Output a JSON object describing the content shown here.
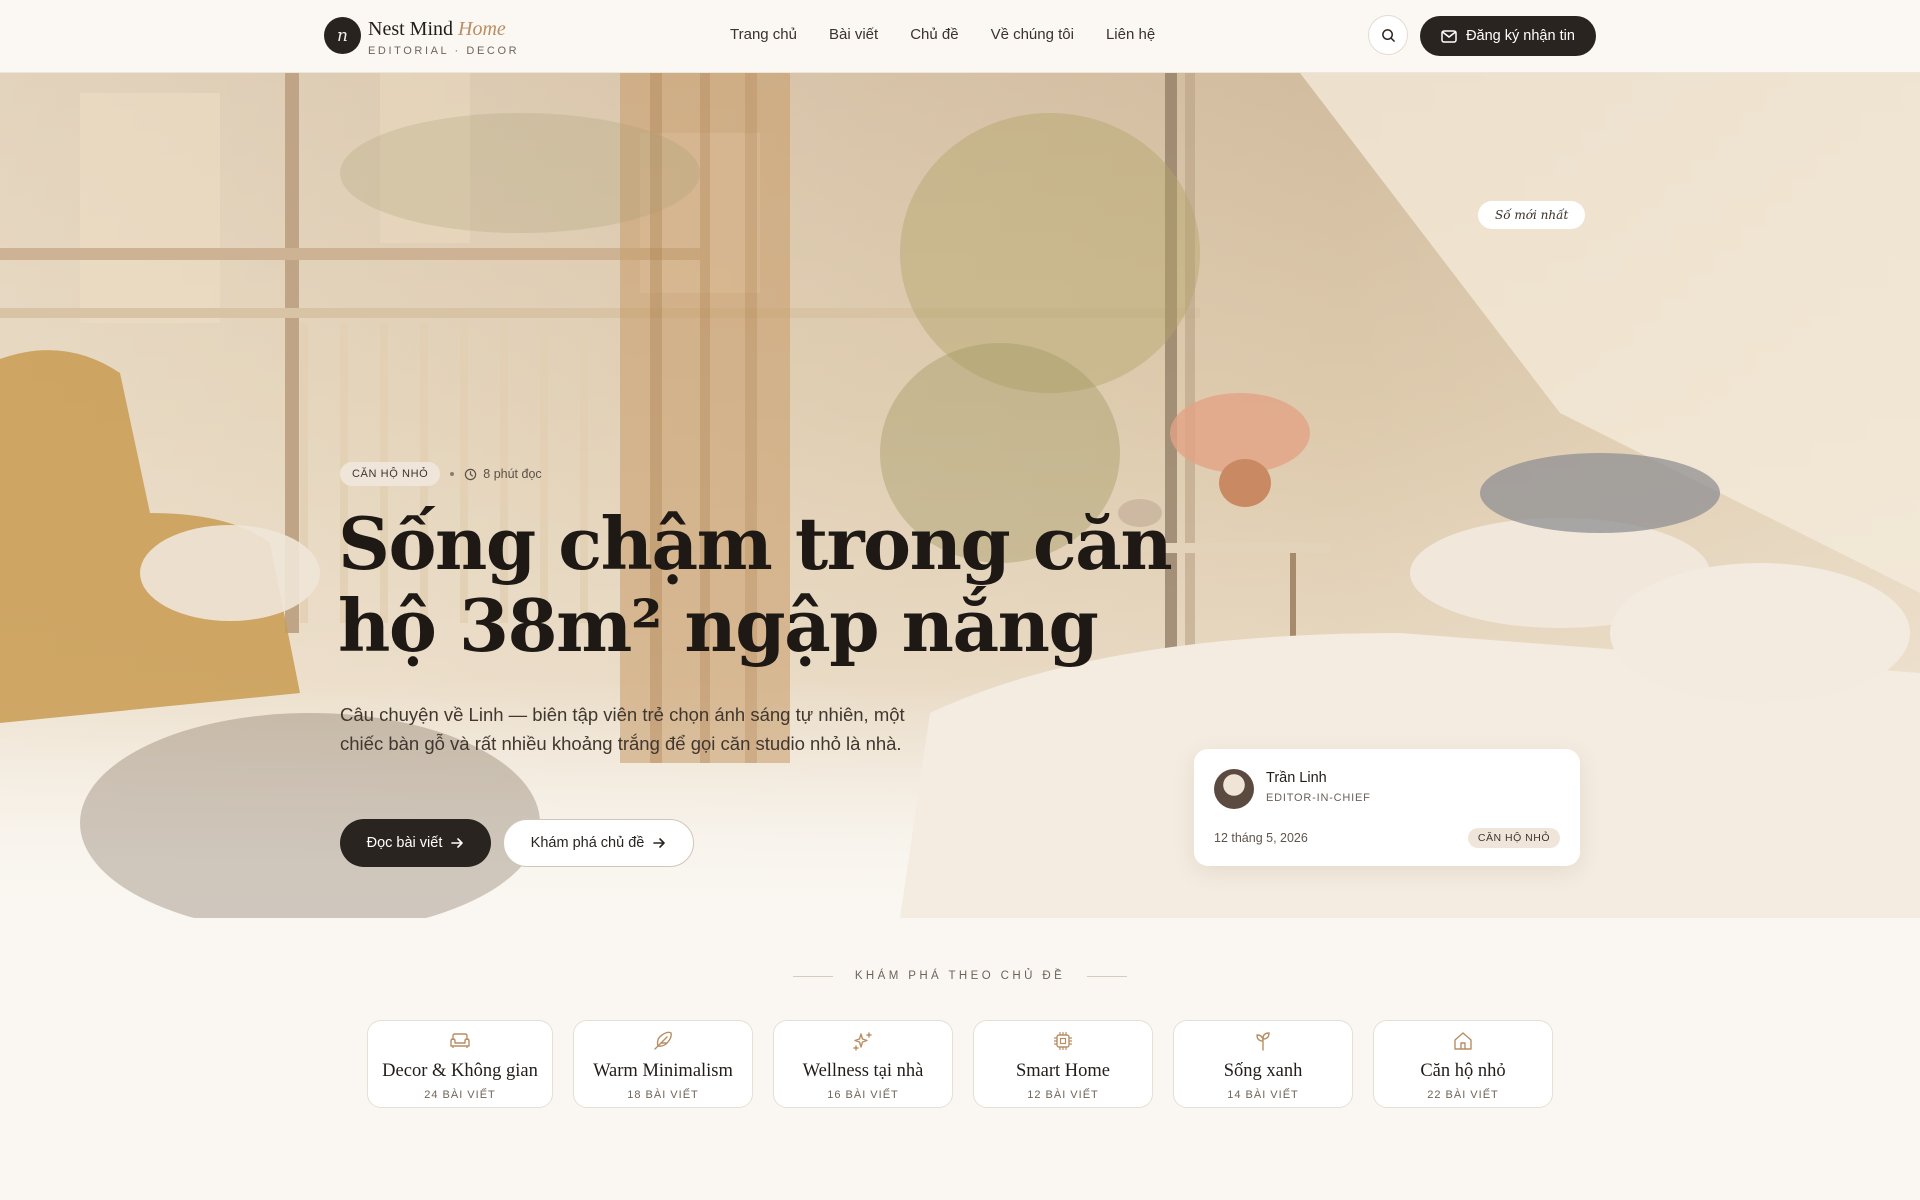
{
  "brand": {
    "mark": "n",
    "name": "Nest Mind",
    "name_accent": "Home",
    "tagline": "EDITORIAL · DECOR"
  },
  "nav": {
    "items": [
      "Trang chủ",
      "Bài viết",
      "Chủ đề",
      "Về chúng tôi",
      "Liên hệ"
    ]
  },
  "header": {
    "search_icon": "search-icon",
    "subscribe_label": "Đăng ký nhận tin",
    "subscribe_icon": "mail-icon"
  },
  "hero": {
    "badge_latest": "Số mới nhất",
    "category": "CĂN HỘ NHỎ",
    "read_time": "8 phút đọc",
    "title": "Sống chậm trong căn hộ 38m² ngập nắng",
    "lead": "Câu chuyện về Linh — biên tập viên trẻ chọn ánh sáng tự nhiên, một chiếc bàn gỗ và rất nhiều khoảng trắng để gọi căn studio nhỏ là nhà.",
    "primary_cta": "Đọc bài viết",
    "secondary_cta": "Khám phá chủ đề"
  },
  "author": {
    "name": "Trần Linh",
    "role": "EDITOR-IN-CHIEF",
    "date": "12 tháng 5, 2026",
    "tag": "CĂN HỘ NHỎ"
  },
  "topics": {
    "heading": "KHÁM PHÁ THEO CHỦ ĐỀ",
    "items": [
      {
        "name": "Decor & Không gian",
        "count": "24 BÀI VIẾT",
        "icon": "sofa-icon"
      },
      {
        "name": "Warm Minimalism",
        "count": "18 BÀI VIẾT",
        "icon": "feather-icon"
      },
      {
        "name": "Wellness tại nhà",
        "count": "16 BÀI VIẾT",
        "icon": "sparkles-icon"
      },
      {
        "name": "Smart Home",
        "count": "12 BÀI VIẾT",
        "icon": "chip-icon"
      },
      {
        "name": "Sống xanh",
        "count": "14 BÀI VIẾT",
        "icon": "sprout-icon"
      },
      {
        "name": "Căn hộ nhỏ",
        "count": "22 BÀI VIẾT",
        "icon": "house-icon"
      }
    ]
  },
  "colors": {
    "accent": "#b88e63",
    "dark": "#2a2420",
    "background": "#faf7f2"
  }
}
